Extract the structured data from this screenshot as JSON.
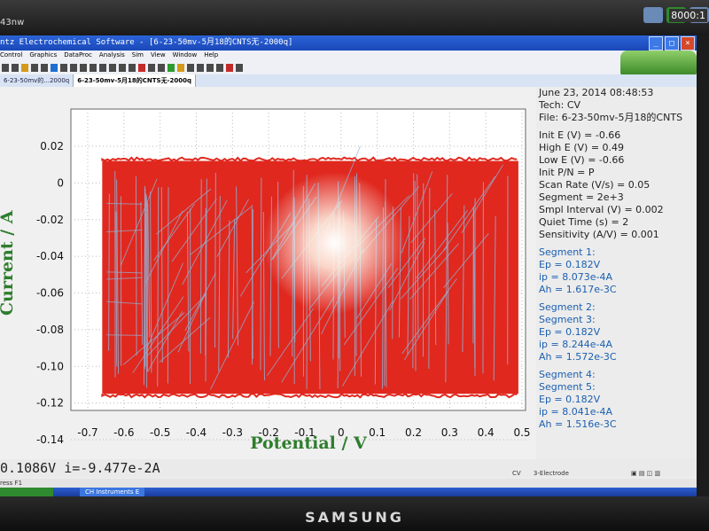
{
  "window": {
    "title": "ntz Electrochemical Software - [6-23-50mv-5月18的CNTS无-2000q]",
    "buttons": [
      "_",
      "□",
      "×"
    ]
  },
  "top_left_text": "43nw",
  "tray_time": "8000:1",
  "menu": [
    "Control",
    "Graphics",
    "DataProc",
    "Analysis",
    "Sim",
    "View",
    "Window",
    "Help"
  ],
  "tabs": [
    "6-23-50mv的...2000q",
    "6-23-50mv-5月18的CNTS无-2000q"
  ],
  "chart_data": {
    "type": "line",
    "xlabel": "Potential / V",
    "ylabel": "Current / A",
    "xlim": [
      -0.7,
      0.5
    ],
    "ylim": [
      -0.14,
      0.02
    ],
    "xticks": [
      "-0.7",
      "-0.6",
      "-0.5",
      "-0.4",
      "-0.3",
      "-0.2",
      "-0.1",
      "0",
      "0.1",
      "0.2",
      "0.3",
      "0.4",
      "0.5"
    ],
    "yticks": [
      "0.02",
      "0",
      "-0.02",
      "-0.04",
      "-0.06",
      "-0.08",
      "-0.10",
      "-0.12",
      "-0.14"
    ],
    "fill_color": "#e0281e",
    "trace_color": "#8fb4d8",
    "band": {
      "x": [
        -0.66,
        0.49
      ],
      "upper": 0.012,
      "lower": -0.115
    }
  },
  "info": {
    "date": "June 23, 2014   08:48:53",
    "tech": "Tech: CV",
    "file": "File: 6-23-50mv-5月18的CNTS",
    "params": [
      "Init E (V) = -0.66",
      "High E (V) = 0.49",
      "Low E (V) = -0.66",
      "Init P/N = P",
      "Scan Rate (V/s) = 0.05",
      "Segment = 2e+3",
      "Smpl Interval (V) = 0.002",
      "Quiet Time (s) = 2",
      "Sensitivity (A/V) = 0.001"
    ],
    "segments": [
      [
        "Segment 1:",
        "Ep = 0.182V",
        "ip = 8.073e-4A",
        "Ah = 1.617e-3C"
      ],
      [
        "Segment 2:",
        "Segment 3:",
        "Ep = 0.182V",
        "ip = 8.244e-4A",
        "Ah = 1.572e-3C"
      ],
      [
        "Segment 4:",
        "Segment 5:",
        "Ep = 0.182V",
        "ip = 8.041e-4A",
        "Ah = 1.516e-3C"
      ]
    ]
  },
  "status": {
    "readout": "0.1086V   i=-9.477e-2A",
    "tech": "CV",
    "electrode": "3-Electrode"
  },
  "hint": "ress F1",
  "taskbar_item": "CH Instruments E",
  "brand": "SAMSUNG"
}
